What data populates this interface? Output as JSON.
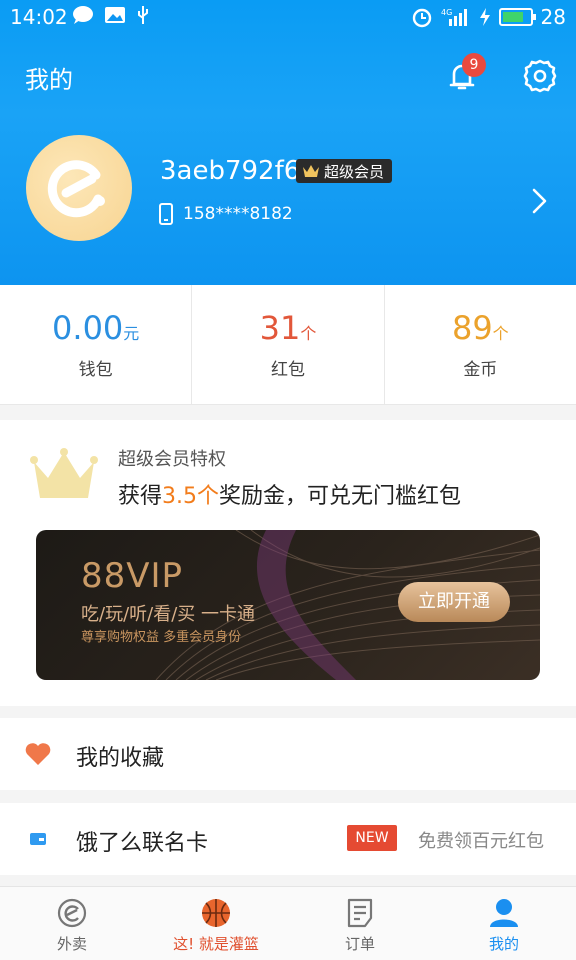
{
  "statusbar": {
    "time": "14:02",
    "battery": "28",
    "signal_label": "4G"
  },
  "header": {
    "title": "我的",
    "notification_count": "9"
  },
  "profile": {
    "username": "3aeb792f6",
    "badge": "超级会员",
    "phone": "158****8182"
  },
  "stats": [
    {
      "value": "0.00",
      "unit": "元",
      "label": "钱包",
      "color": "#2b8fe0"
    },
    {
      "value": "31",
      "unit": "个",
      "label": "红包",
      "color": "#e2573a"
    },
    {
      "value": "89",
      "unit": "个",
      "label": "金币",
      "color": "#eba22c"
    }
  ],
  "vip": {
    "title": "超级会员特权",
    "desc_prefix": "获得",
    "desc_highlight": "3.5个",
    "desc_suffix": "奖励金，可兑无门槛红包",
    "card_title": "88VIP",
    "card_line1": "吃/玩/听/看/买  一卡通",
    "card_line2": "尊享购物权益 多重会员身份",
    "card_button": "立即开通"
  },
  "rows": {
    "favorites": "我的收藏",
    "card": "饿了么联名卡",
    "card_badge": "NEW",
    "card_hint": "免费领百元红包"
  },
  "bottom_nav": [
    {
      "label": "外卖",
      "icon": "eleme-logo-icon"
    },
    {
      "label": "这! 就是灌篮",
      "icon": "basketball-icon"
    },
    {
      "label": "订单",
      "icon": "order-list-icon"
    },
    {
      "label": "我的",
      "icon": "user-icon"
    }
  ],
  "colors": {
    "brand_blue": "#0d96f2",
    "accent_orange": "#f27c1b",
    "badge_red": "#e54a32"
  }
}
